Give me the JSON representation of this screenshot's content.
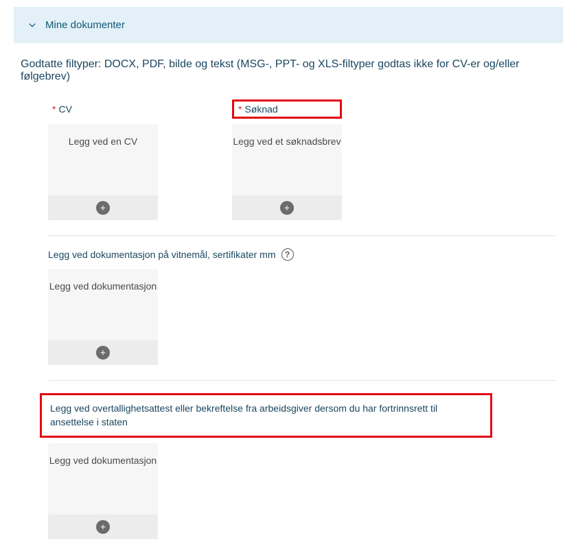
{
  "panel": {
    "title": "Mine dokumenter"
  },
  "filetypes_note": "Godtatte filtyper: DOCX, PDF, bilde og tekst (MSG-, PPT- og XLS-filtyper godtas ikke for CV-er og/eller følgebrev)",
  "required_mark": "*",
  "cv": {
    "label": "CV",
    "card_text": "Legg ved en CV"
  },
  "soknad": {
    "label": "Søknad",
    "card_text": "Legg ved et søknadsbrev"
  },
  "doc_section": {
    "label": "Legg ved dokumentasjon på vitnemål, sertifikater mm",
    "card_text": "Legg ved dokumentasjon",
    "help_glyph": "?"
  },
  "overt_section": {
    "label": "Legg ved overtallighetsattest eller bekreftelse fra arbeidsgiver dersom du har fortrinnsrett til ansettelse i staten",
    "card_text": "Legg ved dokumentasjon"
  }
}
